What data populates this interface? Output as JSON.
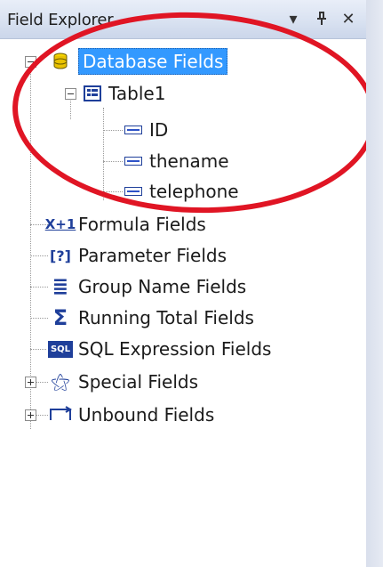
{
  "panel": {
    "title": "Field Explorer",
    "buttons": {
      "dropdown": "▾",
      "pin": "ᵖ",
      "close": "✕"
    }
  },
  "tree": {
    "database_fields": "Database Fields",
    "table": "Table1",
    "fields": [
      "ID",
      "thename",
      "telephone"
    ],
    "formula_fields": "Formula Fields",
    "parameter_fields": "Parameter Fields",
    "group_name_fields": "Group Name Fields",
    "running_total_fields": "Running Total Fields",
    "sql_expression_fields": "SQL Expression Fields",
    "special_fields": "Special Fields",
    "unbound_fields": "Unbound Fields"
  },
  "icons": {
    "formula": "X+1",
    "parameter": "[?]",
    "group": "≣",
    "running_total": "Σ",
    "sql": "SQL",
    "special": "⚝",
    "unbound": "⎴"
  },
  "colors": {
    "selection": "#3399ff",
    "annotation": "#e01524",
    "icon_blue": "#1f3f9a"
  }
}
